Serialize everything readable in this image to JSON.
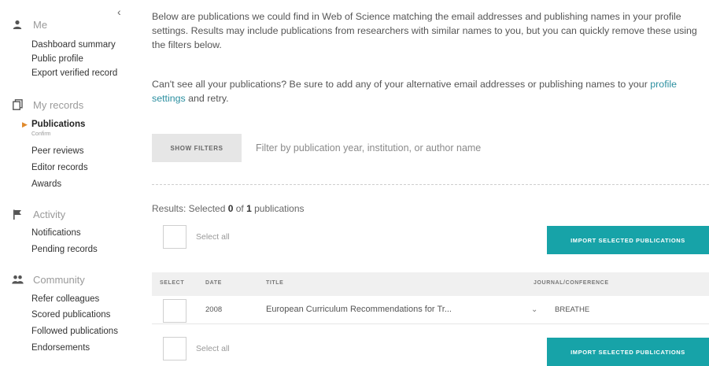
{
  "sidebar": {
    "collapse_icon": "chevron-left-icon",
    "sections": [
      {
        "label": "Me",
        "icon": "person-icon",
        "items": [
          "Dashboard summary",
          "Public profile",
          "Export verified record"
        ]
      },
      {
        "label": "My records",
        "icon": "documents-icon",
        "items": [
          "Publications",
          "Confirm",
          "Peer reviews",
          "Editor records",
          "Awards"
        ],
        "active_item": "Publications"
      },
      {
        "label": "Activity",
        "icon": "flag-icon",
        "items": [
          "Notifications",
          "Pending records"
        ]
      },
      {
        "label": "Community",
        "icon": "people-icon",
        "items": [
          "Refer colleagues",
          "Scored publications",
          "Followed publications",
          "Endorsements"
        ]
      }
    ]
  },
  "intro": {
    "paragraph1": "Below are publications we could find in Web of Science matching the email addresses and publishing names in your profile settings. Results may include publications from researchers with similar names to you, but you can quickly remove these using the filters below.",
    "paragraph2_prefix": "Can't see all your publications? Be sure to add any of your alternative email addresses or publishing names to your ",
    "paragraph2_link": "profile settings",
    "paragraph2_suffix": " and retry."
  },
  "filters": {
    "button_label": "SHOW FILTERS",
    "placeholder": "Filter by publication year, institution, or author name"
  },
  "results": {
    "prefix": "Results: Selected ",
    "selected": "0",
    "middle": " of ",
    "total": "1",
    "suffix": " publications"
  },
  "select_all_label": "Select all",
  "import_button_label": "IMPORT SELECTED PUBLICATIONS",
  "table": {
    "headers": [
      "SELECT",
      "DATE",
      "TITLE",
      "JOURNAL/CONFERENCE"
    ],
    "rows": [
      {
        "date": "2008",
        "title": "European Curriculum Recommendations for Tr...",
        "journal": "BREATHE"
      }
    ]
  },
  "colors": {
    "accent": "#17a3a8",
    "link": "#2b8fa0",
    "active_marker": "#e08a2c"
  }
}
